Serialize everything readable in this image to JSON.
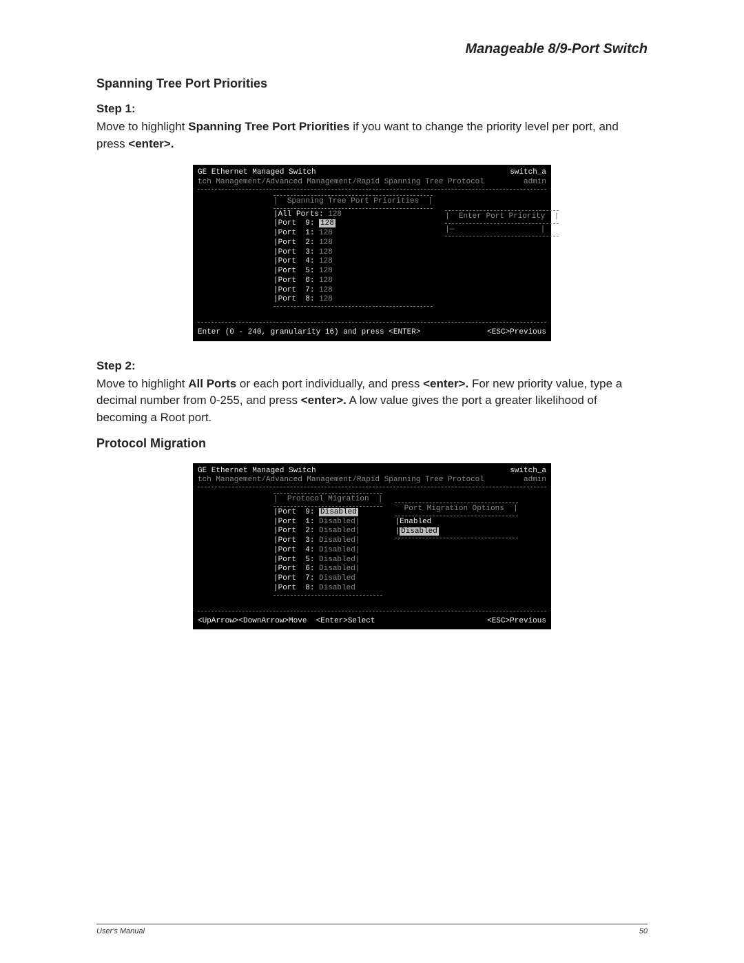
{
  "header": {
    "title": "Manageable 8/9-Port Switch"
  },
  "section1": {
    "title": "Spanning Tree Port Priorities",
    "step1": {
      "label": "Step 1:",
      "text_before": "Move to highlight ",
      "bold1": "Spanning Tree Port Priorities",
      "text_mid": " if you want to change the priority level per port, and press ",
      "bold2": "<enter>."
    },
    "step2": {
      "label": "Step 2:",
      "text_a": "Move to highlight ",
      "bold_a": "All Ports",
      "text_b": " or each port individually, and press ",
      "bold_b": "<enter>.",
      "text_c": " For new priority value, type a decimal number from 0-255, and press ",
      "bold_c": "<enter>.",
      "text_d": " A low value gives the port a greater likelihood of becoming a Root port."
    }
  },
  "section2": {
    "title": "Protocol Migration"
  },
  "terminal1": {
    "title_left": "GE Ethernet Managed Switch",
    "title_right_top": "switch_a",
    "title_right_bot": "admin",
    "breadcrumb": "tch Management/Advanced Management/Rapid Spanning Tree Protocol",
    "panel_title": "Spanning Tree Port Priorities",
    "all_ports_label": "All Ports:",
    "all_ports_value": "128",
    "ports": [
      {
        "label": "Port  9:",
        "value": "128",
        "highlight": true
      },
      {
        "label": "Port  1:",
        "value": "128"
      },
      {
        "label": "Port  2:",
        "value": "128"
      },
      {
        "label": "Port  3:",
        "value": "128"
      },
      {
        "label": "Port  4:",
        "value": "128"
      },
      {
        "label": "Port  5:",
        "value": "128"
      },
      {
        "label": "Port  6:",
        "value": "128"
      },
      {
        "label": "Port  7:",
        "value": "128"
      },
      {
        "label": "Port  8:",
        "value": "128"
      }
    ],
    "right_title": "Enter Port Priority",
    "right_input": "—",
    "footer_left": "Enter (0 - 240, granularity 16) and press <ENTER>",
    "footer_right": "<ESC>Previous"
  },
  "terminal2": {
    "title_left": "GE Ethernet Managed Switch",
    "title_right_top": "switch_a",
    "title_right_bot": "admin",
    "breadcrumb": "tch Management/Advanced Management/Rapid Spanning Tree Protocol",
    "panel_title": "Protocol Migration",
    "ports": [
      {
        "label": "Port  9:",
        "value": "Disabled",
        "highlight": true
      },
      {
        "label": "Port  1:",
        "value": "Disabled"
      },
      {
        "label": "Port  2:",
        "value": "Disabled"
      },
      {
        "label": "Port  3:",
        "value": "Disabled"
      },
      {
        "label": "Port  4:",
        "value": "Disabled"
      },
      {
        "label": "Port  5:",
        "value": "Disabled"
      },
      {
        "label": "Port  6:",
        "value": "Disabled"
      },
      {
        "label": "Port  7:",
        "value": "Disabled"
      },
      {
        "label": "Port  8:",
        "value": "Disabled"
      }
    ],
    "right_title": "Port Migration Options",
    "options": [
      {
        "label": "Enabled",
        "highlight": false
      },
      {
        "label": "Disabled",
        "highlight": true
      }
    ],
    "footer_left": "<UpArrow><DownArrow>Move  <Enter>Select",
    "footer_right": "<ESC>Previous"
  },
  "footer": {
    "left": "User's Manual",
    "right": "50"
  }
}
